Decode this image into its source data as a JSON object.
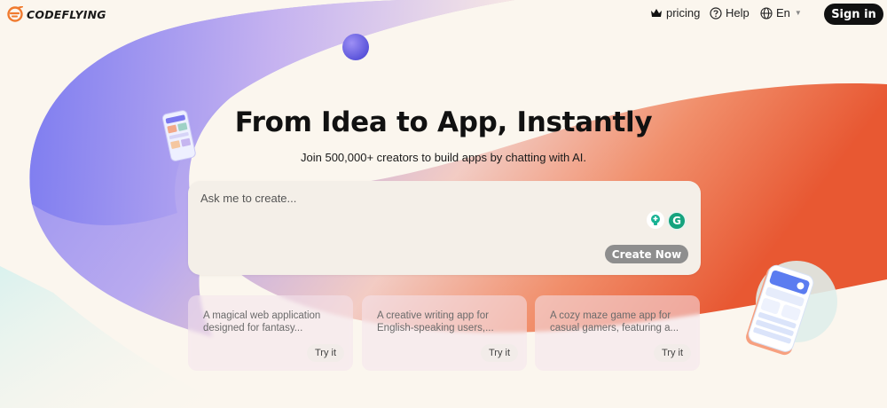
{
  "header": {
    "brand": "CODEFLYING",
    "pricing_label": "pricing",
    "help_label": "Help",
    "lang_label": "En",
    "signin_label": "Sign in"
  },
  "hero": {
    "title": "From Idea to App, Instantly",
    "subtitle": "Join 500,000+ creators to build apps by chatting with AI."
  },
  "prompt": {
    "placeholder": "Ask me to create...",
    "create_label": "Create Now"
  },
  "examples": [
    {
      "text": "A magical web application designed for fantasy...",
      "try_label": "Try it"
    },
    {
      "text": "A creative writing app for English-speaking users,...",
      "try_label": "Try it"
    },
    {
      "text": "A cozy maze game app for casual gamers, featuring a...",
      "try_label": "Try it"
    }
  ],
  "colors": {
    "brand_orange": "#f07a2e",
    "accent_purple": "#7c79f0",
    "accent_red": "#e8502a",
    "signin_bg": "#111111"
  }
}
